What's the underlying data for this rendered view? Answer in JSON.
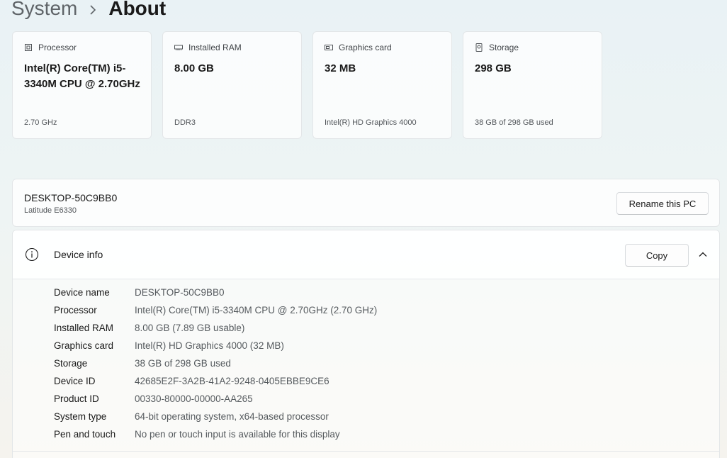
{
  "breadcrumb": {
    "parent": "System",
    "current": "About"
  },
  "cards": [
    {
      "icon": "processor-icon",
      "title": "Processor",
      "value": "Intel(R) Core(TM) i5-3340M CPU @ 2.70GHz",
      "sub": "2.70 GHz"
    },
    {
      "icon": "ram-icon",
      "title": "Installed RAM",
      "value": "8.00 GB",
      "sub": "DDR3"
    },
    {
      "icon": "graphics-card-icon",
      "title": "Graphics card",
      "value": "32 MB",
      "sub": "Intel(R) HD Graphics 4000"
    },
    {
      "icon": "storage-icon",
      "title": "Storage",
      "value": "298 GB",
      "sub": "38 GB of 298 GB used"
    }
  ],
  "pc": {
    "name": "DESKTOP-50C9BB0",
    "model": "Latitude E6330",
    "rename_label": "Rename this PC"
  },
  "device_info": {
    "title": "Device info",
    "copy_label": "Copy",
    "rows": [
      {
        "label": "Device name",
        "value": "DESKTOP-50C9BB0"
      },
      {
        "label": "Processor",
        "value": "Intel(R) Core(TM) i5-3340M CPU @ 2.70GHz (2.70 GHz)"
      },
      {
        "label": "Installed RAM",
        "value": "8.00 GB (7.89 GB usable)"
      },
      {
        "label": "Graphics card",
        "value": "Intel(R) HD Graphics 4000 (32 MB)"
      },
      {
        "label": "Storage",
        "value": "38 GB of 298 GB used"
      },
      {
        "label": "Device ID",
        "value": "42685E2F-3A2B-41A2-9248-0405EBBE9CE6"
      },
      {
        "label": "Product ID",
        "value": "00330-80000-00000-AA265"
      },
      {
        "label": "System type",
        "value": "64-bit operating system, x64-based processor"
      },
      {
        "label": "Pen and touch",
        "value": "No pen or touch input is available for this display"
      }
    ]
  },
  "colors": {
    "accent": "#1a1a1a",
    "secondary_text": "#555a5e"
  }
}
